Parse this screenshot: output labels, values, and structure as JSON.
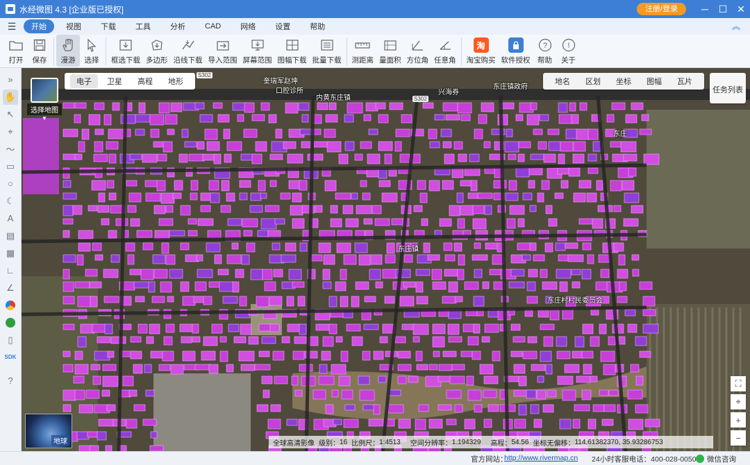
{
  "app": {
    "title": "水经微图 4.3 [企业版已授权]",
    "login_label": "注册/登录",
    "window_controls": [
      "minimize-icon",
      "maximize-icon",
      "close-icon"
    ]
  },
  "menu": {
    "items": [
      "开始",
      "视图",
      "下载",
      "工具",
      "分析",
      "CAD",
      "网络",
      "设置",
      "帮助"
    ],
    "active": "开始"
  },
  "toolbar": {
    "items": [
      {
        "label": "打开",
        "icon": "folder-icon",
        "dropdown": true
      },
      {
        "label": "保存",
        "icon": "save-icon"
      },
      {
        "label": "漫游",
        "icon": "hand-icon",
        "active": true
      },
      {
        "label": "选择",
        "icon": "pointer-icon"
      },
      {
        "label": "框选下载",
        "icon": "box-download-icon"
      },
      {
        "label": "多边形",
        "icon": "polygon-download-icon"
      },
      {
        "label": "沿线下载",
        "icon": "line-download-icon"
      },
      {
        "label": "导入范围",
        "icon": "import-range-icon"
      },
      {
        "label": "屏幕范围",
        "icon": "screen-range-icon"
      },
      {
        "label": "图幅下载",
        "icon": "sheet-download-icon",
        "dropdown": true
      },
      {
        "label": "批量下载",
        "icon": "batch-download-icon"
      },
      {
        "label": "测距离",
        "icon": "ruler-icon"
      },
      {
        "label": "量面积",
        "icon": "area-icon"
      },
      {
        "label": "方位角",
        "icon": "bearing-icon"
      },
      {
        "label": "任意角",
        "icon": "angle-icon"
      },
      {
        "label": "淘宝购买",
        "icon": "taobao-icon",
        "glyph": "淘"
      },
      {
        "label": "软件授权",
        "icon": "license-icon"
      },
      {
        "label": "帮助",
        "icon": "help-icon"
      },
      {
        "label": "关于",
        "icon": "info-icon"
      }
    ]
  },
  "left_tools": [
    "expand-icon",
    "hand-icon",
    "pointer-icon",
    "pin-icon",
    "polyline-icon",
    "rectangle-icon",
    "circle-icon",
    "crescent-icon",
    "text-icon",
    "ruler-icon",
    "area-icon",
    "bearing-icon",
    "angle-icon",
    "layer-color-icon",
    "chain-icon",
    "phone-icon",
    "sdk-icon",
    "help-icon"
  ],
  "map": {
    "layer_switch_label": "选择地图",
    "map_types": [
      "电子",
      "卫星",
      "高程",
      "地形"
    ],
    "active_map_type": "电子",
    "layer_tabs": [
      "地名",
      "区划",
      "坐标",
      "图幅",
      "瓦片"
    ],
    "task_list_label": "任务列表",
    "globe_label": "地球",
    "place_labels": [
      "奎瑞军赵坤",
      "口腔诊所",
      "内黄东庄镇",
      "东庄镇政府",
      "东庄",
      "东庄镇",
      "东庄村村民委员会",
      "兴海券"
    ],
    "road_shields": [
      "S302",
      "S302"
    ],
    "zoom_controls": [
      "fullscreen-icon",
      "locate-icon",
      "zoom-in-icon",
      "zoom-out-icon"
    ]
  },
  "coord_bar": {
    "source": "全球高清影像",
    "level_label": "级别：",
    "level": "16",
    "scale_label": "比例尺：",
    "scale": "1:4513",
    "resolution_label": "空间分辨率：",
    "resolution": "1.194329",
    "elevation_label": "高程：",
    "elevation": "54.56",
    "coord_label": "坐标无偏移：",
    "coords": "114.61382370, 35.93286753"
  },
  "statusbar": {
    "website_label": "官方网站：",
    "website": "http://www.rivermap.cn",
    "hotline": "24小时客服电话：400-028-0050",
    "wechat": "微信咨询"
  },
  "colors": {
    "titlebar": "#3d7fd6",
    "accent": "#3d7fd6",
    "login": "#f39a24",
    "building_overlay": "#d04ee0",
    "road": "#2a2a2a"
  }
}
